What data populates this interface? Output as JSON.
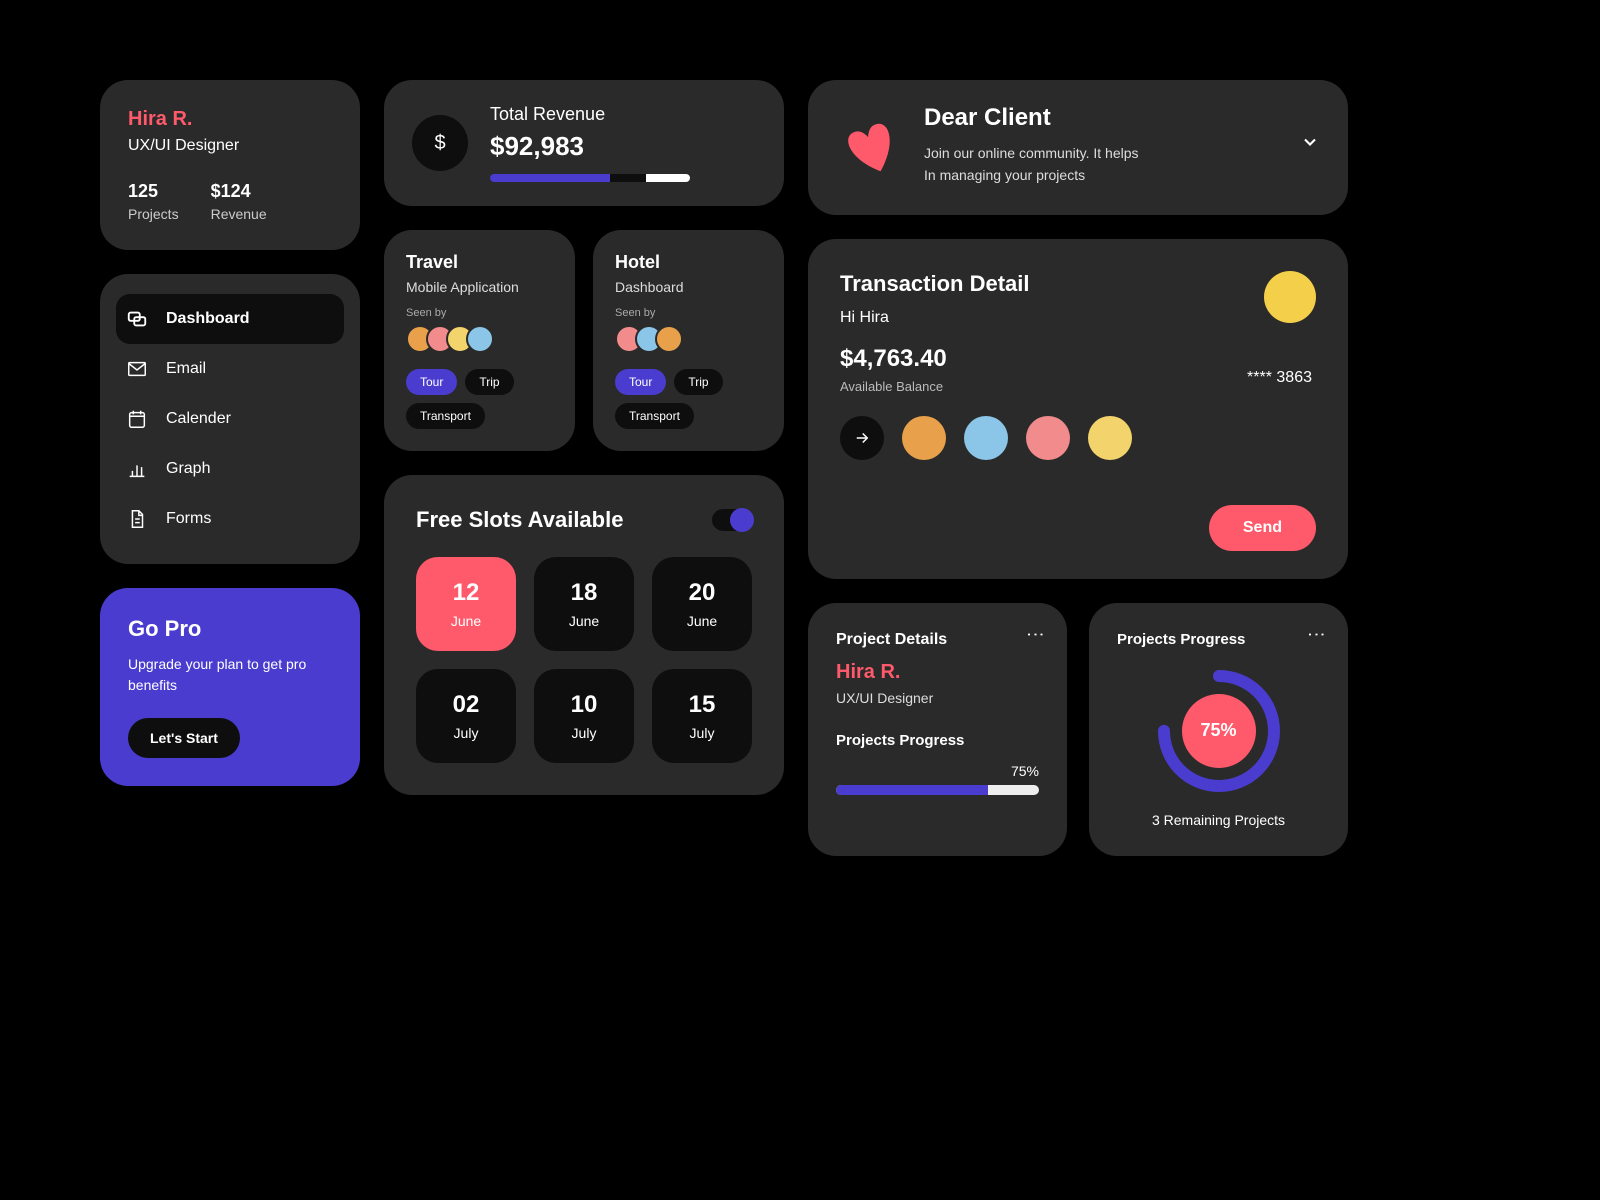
{
  "profile": {
    "name": "Hira R.",
    "role": "UX/UI Designer",
    "projects_value": "125",
    "projects_label": "Projects",
    "revenue_value": "$124",
    "revenue_label": "Revenue"
  },
  "nav": {
    "items": [
      {
        "label": "Dashboard",
        "active": true
      },
      {
        "label": "Email"
      },
      {
        "label": "Calender"
      },
      {
        "label": "Graph"
      },
      {
        "label": "Forms"
      }
    ]
  },
  "gopro": {
    "title": "Go Pro",
    "desc": "Upgrade your plan to get pro benefits",
    "button": "Let's Start"
  },
  "revenue": {
    "title": "Total Revenue",
    "amount": "$92,983"
  },
  "categories": [
    {
      "title": "Travel",
      "subtitle": "Mobile Application",
      "seen": "Seen by",
      "tags": [
        {
          "label": "Tour",
          "active": true
        },
        {
          "label": "Trip"
        },
        {
          "label": "Transport"
        }
      ]
    },
    {
      "title": "Hotel",
      "subtitle": "Dashboard",
      "seen": "Seen by",
      "tags": [
        {
          "label": "Tour",
          "active": true
        },
        {
          "label": "Trip"
        },
        {
          "label": "Transport"
        }
      ]
    }
  ],
  "slots": {
    "title": "Free Slots Available",
    "items": [
      {
        "day": "12",
        "month": "June",
        "active": true
      },
      {
        "day": "18",
        "month": "June"
      },
      {
        "day": "20",
        "month": "June"
      },
      {
        "day": "02",
        "month": "July"
      },
      {
        "day": "10",
        "month": "July"
      },
      {
        "day": "15",
        "month": "July"
      }
    ]
  },
  "banner": {
    "title": "Dear Client",
    "line1": "Join our online community. It helps",
    "line2": "In managing your projects"
  },
  "transaction": {
    "title": "Transaction Detail",
    "greeting": "Hi Hira",
    "balance": "$4,763.40",
    "balance_label": "Available Balance",
    "card_mask": "**** 3863",
    "send": "Send"
  },
  "project_details": {
    "title": "Project Details",
    "name": "Hira R.",
    "role": "UX/UI Designer",
    "progress_title": "Projects Progress",
    "percent": "75%"
  },
  "progress_ring": {
    "title": "Projects Progress",
    "percent": "75%",
    "remaining": "3 Remaining Projects"
  }
}
